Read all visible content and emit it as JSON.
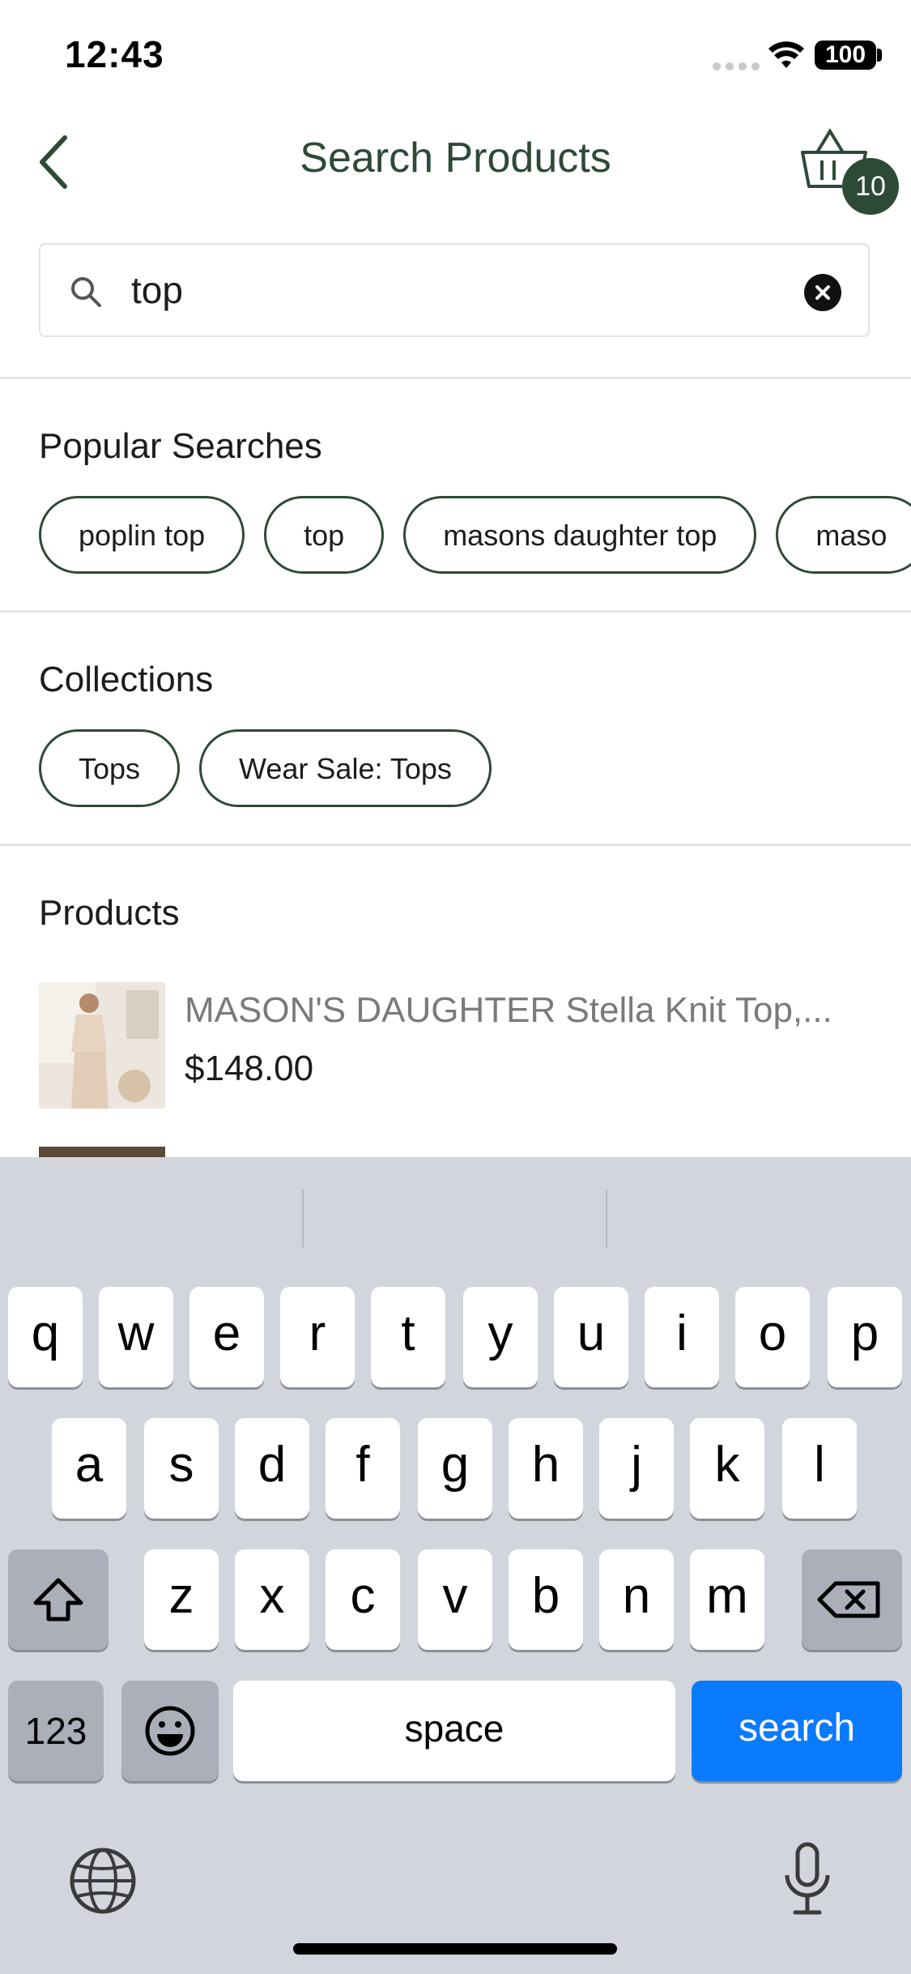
{
  "status_bar": {
    "time": "12:43",
    "battery": "100"
  },
  "header": {
    "title": "Search Products",
    "cart_count": "10"
  },
  "search": {
    "value": "top"
  },
  "popular": {
    "title": "Popular Searches",
    "chips": [
      "poplin top",
      "top",
      "masons daughter top",
      "maso"
    ]
  },
  "collections": {
    "title": "Collections",
    "chips": [
      "Tops",
      "Wear Sale: Tops"
    ]
  },
  "products": {
    "title": "Products",
    "items": [
      {
        "name": "MASON'S DAUGHTER Stella Knit Top,...",
        "price": "$148.00"
      }
    ]
  },
  "keyboard": {
    "row1": [
      "q",
      "w",
      "e",
      "r",
      "t",
      "y",
      "u",
      "i",
      "o",
      "p"
    ],
    "row2": [
      "a",
      "s",
      "d",
      "f",
      "g",
      "h",
      "j",
      "k",
      "l"
    ],
    "row3": [
      "z",
      "x",
      "c",
      "v",
      "b",
      "n",
      "m"
    ],
    "numbers_label": "123",
    "space_label": "space",
    "action_label": "search"
  },
  "colors": {
    "brand": "#2d4a37",
    "action_key": "#0a7aff",
    "keyboard_bg": "#d3d5dc"
  }
}
